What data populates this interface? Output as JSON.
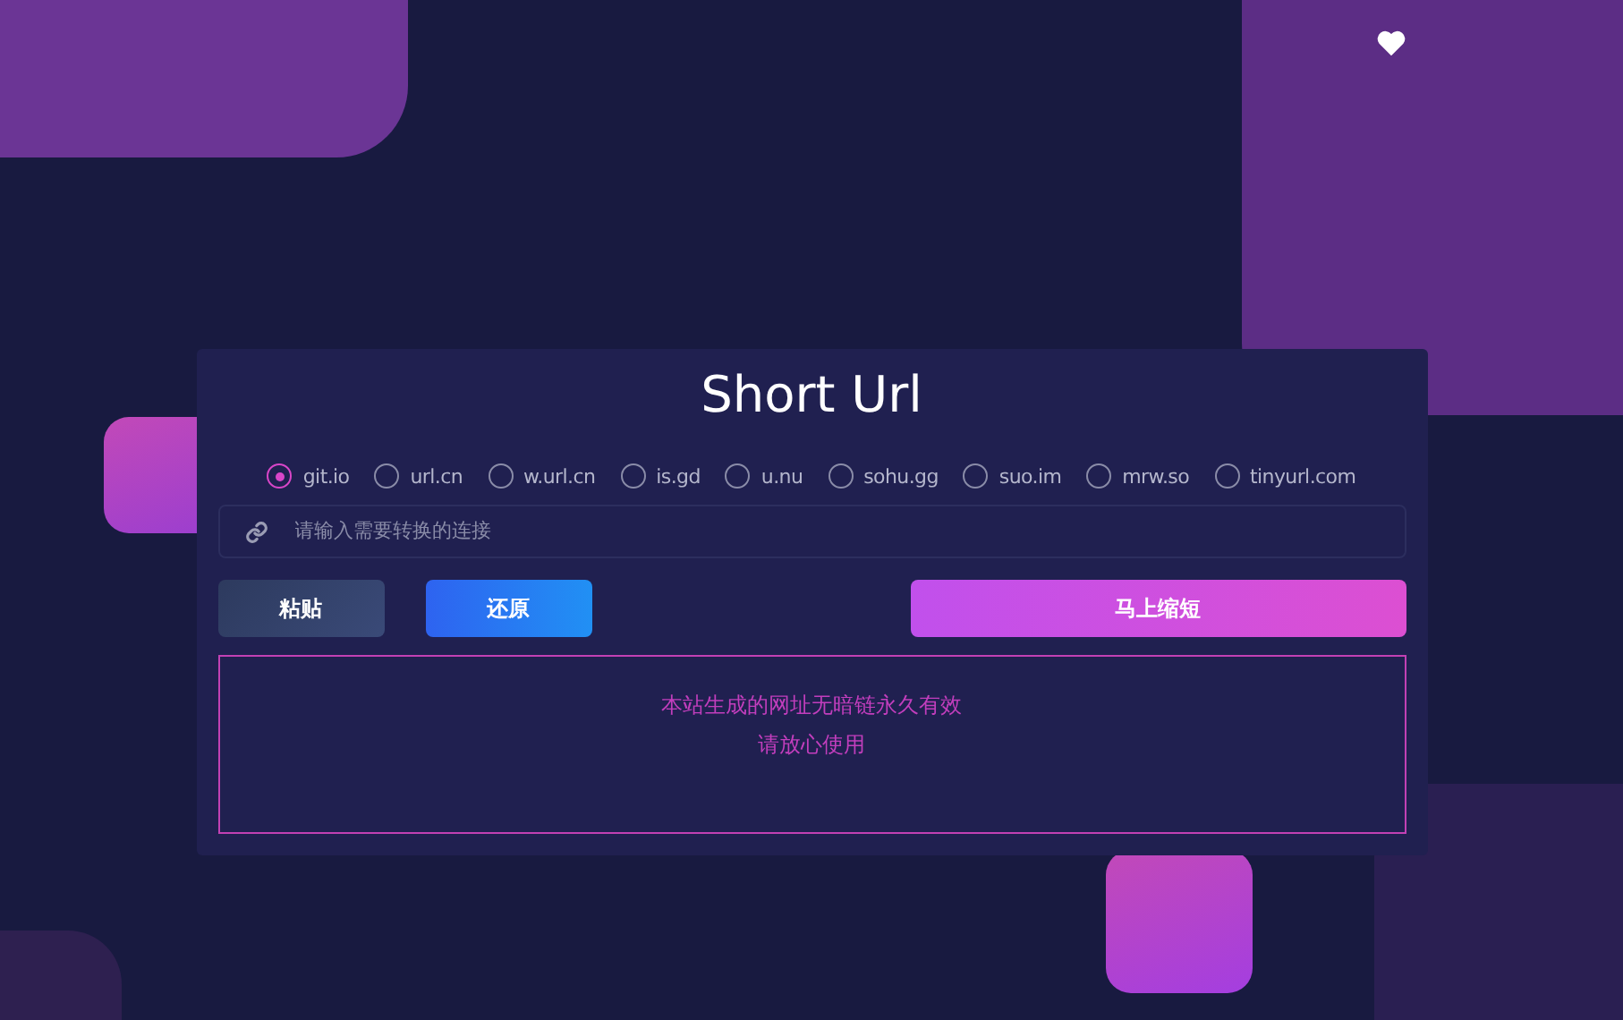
{
  "title": "Short Url",
  "services": [
    {
      "label": "git.io",
      "selected": true
    },
    {
      "label": "url.cn",
      "selected": false
    },
    {
      "label": "w.url.cn",
      "selected": false
    },
    {
      "label": "is.gd",
      "selected": false
    },
    {
      "label": "u.nu",
      "selected": false
    },
    {
      "label": "sohu.gg",
      "selected": false
    },
    {
      "label": "suo.im",
      "selected": false
    },
    {
      "label": "mrw.so",
      "selected": false
    },
    {
      "label": "tinyurl.com",
      "selected": false
    }
  ],
  "url_field": {
    "placeholder": "请输入需要转换的连接"
  },
  "buttons": [
    {
      "label": "粘贴",
      "kind": "paste"
    },
    {
      "label": "还原",
      "kind": "restore"
    },
    {
      "label": "马上缩短",
      "kind": "shorten"
    }
  ],
  "result": {
    "lines": [
      "本站生成的网址无暗链永久有效",
      "请放心使用"
    ]
  }
}
